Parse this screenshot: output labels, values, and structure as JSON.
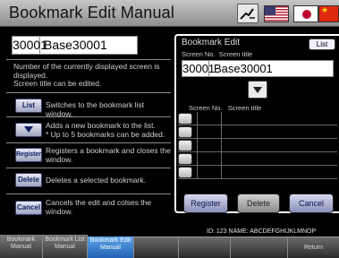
{
  "header": {
    "title": "Bookmark Edit Manual"
  },
  "left": {
    "screen_no": "30001",
    "screen_title": "Base30001",
    "desc_top": "Number of the currently displayed screen is displayed.\nScreen title can be edited.",
    "items": [
      {
        "button": "List",
        "desc": "Switches to the bookmark list window."
      },
      {
        "button": "",
        "desc": "Adds a new bookmark to the list.\n* Up to 5 bookmarks can be added."
      },
      {
        "button": "Register",
        "desc": "Registers a bookmark and closes the window."
      },
      {
        "button": "Delete",
        "desc": "Deletes a selected bookmark."
      },
      {
        "button": "Cancel",
        "desc": "Cancels the edit and colses the window."
      }
    ]
  },
  "right": {
    "title": "Bookmark Edit",
    "list_label": "List",
    "screen_no_label": "Screen No.",
    "screen_title_label": "Screen title",
    "screen_no": "30001",
    "screen_title": "Base30001",
    "col_screen_no": "Screen No.",
    "col_screen_title": "Screen title",
    "register": "Register",
    "delete": "Delete",
    "cancel": "Cancel"
  },
  "status": {
    "text": "ID: 123     NAME: ABCDEFGHIJKLMNOP"
  },
  "tabs": [
    {
      "label": "Bookmark Manual"
    },
    {
      "label": "Bookmark List Manual"
    },
    {
      "label": "Bookmark Edit Manual"
    },
    {
      "label": ""
    },
    {
      "label": ""
    },
    {
      "label": ""
    },
    {
      "label": "Return"
    }
  ]
}
